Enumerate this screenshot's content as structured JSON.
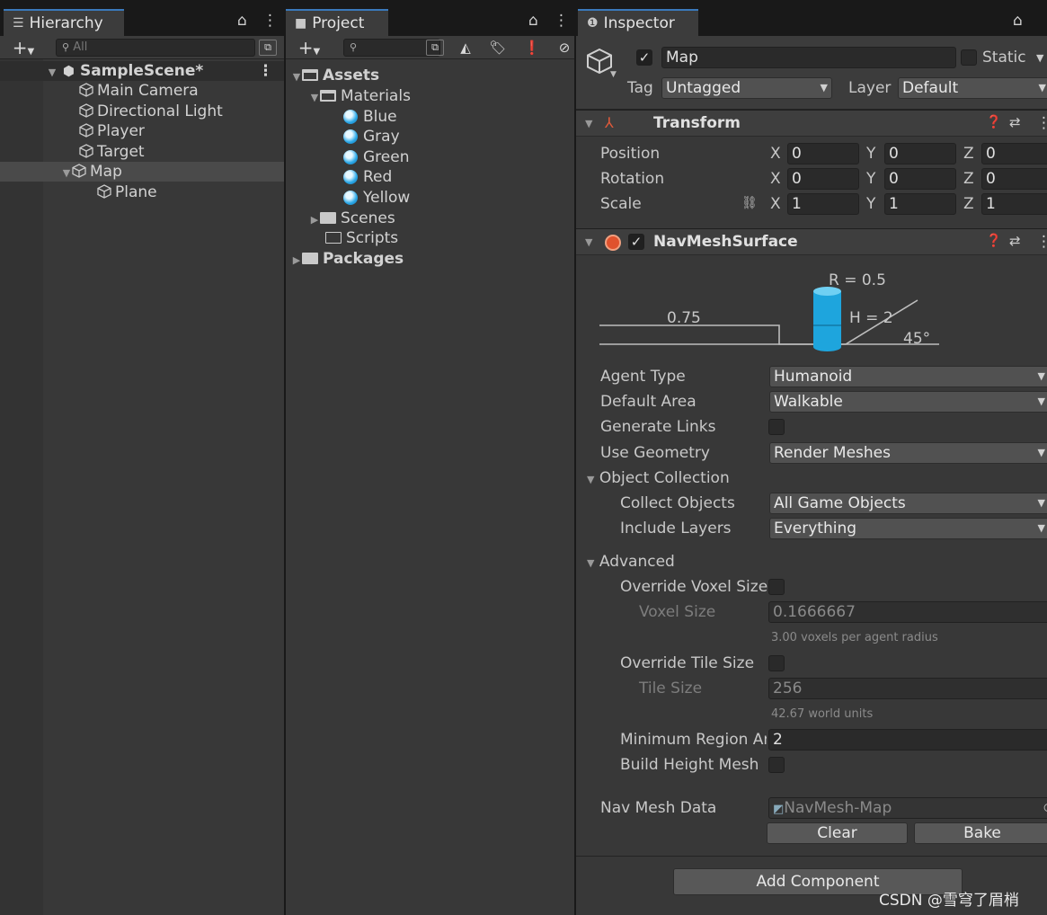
{
  "hierarchy": {
    "tab_label": "Hierarchy",
    "search_placeholder": "All",
    "scene_name": "SampleScene*",
    "items": [
      {
        "label": "Main Camera"
      },
      {
        "label": "Directional Light"
      },
      {
        "label": "Player"
      },
      {
        "label": "Target"
      },
      {
        "label": "Map"
      },
      {
        "label": "Plane"
      }
    ]
  },
  "project": {
    "tab_label": "Project",
    "tree": {
      "assets": "Assets",
      "materials": "Materials",
      "material_items": [
        "Blue",
        "Gray",
        "Green",
        "Red",
        "Yellow"
      ],
      "scenes": "Scenes",
      "scripts": "Scripts",
      "packages": "Packages"
    },
    "colors": {
      "material_ball": "#2aa8e8"
    }
  },
  "inspector": {
    "tab_label": "Inspector",
    "object_name": "Map",
    "static_label": "Static",
    "tag_label": "Tag",
    "tag_value": "Untagged",
    "layer_label": "Layer",
    "layer_value": "Default",
    "transform": {
      "title": "Transform",
      "position_label": "Position",
      "rotation_label": "Rotation",
      "scale_label": "Scale",
      "position": {
        "x": "0",
        "y": "0",
        "z": "0"
      },
      "rotation": {
        "x": "0",
        "y": "0",
        "z": "0"
      },
      "scale": {
        "x": "1",
        "y": "1",
        "z": "1"
      },
      "axis_x": "X",
      "axis_y": "Y",
      "axis_z": "Z"
    },
    "navmesh": {
      "title": "NavMeshSurface",
      "diagram": {
        "radius": "R = 0.5",
        "height": "H = 2",
        "step": "0.75",
        "slope": "45°"
      },
      "agent_type_label": "Agent Type",
      "agent_type_value": "Humanoid",
      "default_area_label": "Default Area",
      "default_area_value": "Walkable",
      "generate_links_label": "Generate Links",
      "use_geometry_label": "Use Geometry",
      "use_geometry_value": "Render Meshes",
      "object_collection_label": "Object Collection",
      "collect_objects_label": "Collect Objects",
      "collect_objects_value": "All Game Objects",
      "include_layers_label": "Include Layers",
      "include_layers_value": "Everything",
      "advanced_label": "Advanced",
      "override_voxel_label": "Override Voxel Size",
      "voxel_size_label": "Voxel Size",
      "voxel_size_value": "0.1666667",
      "voxel_hint": "3.00 voxels per agent radius",
      "override_tile_label": "Override Tile Size",
      "tile_size_label": "Tile Size",
      "tile_size_value": "256",
      "tile_hint": "42.67 world units",
      "min_region_label": "Minimum Region Are",
      "min_region_value": "2",
      "build_height_label": "Build Height Mesh",
      "navmesh_data_label": "Nav Mesh Data",
      "navmesh_data_value": "NavMesh-Map",
      "clear_label": "Clear",
      "bake_label": "Bake"
    },
    "add_component_label": "Add Component"
  },
  "watermark": "CSDN @雪穹了眉梢",
  "colors": {
    "accent_tab": "#3a79bb",
    "cylinder": "#1ea5dd"
  }
}
